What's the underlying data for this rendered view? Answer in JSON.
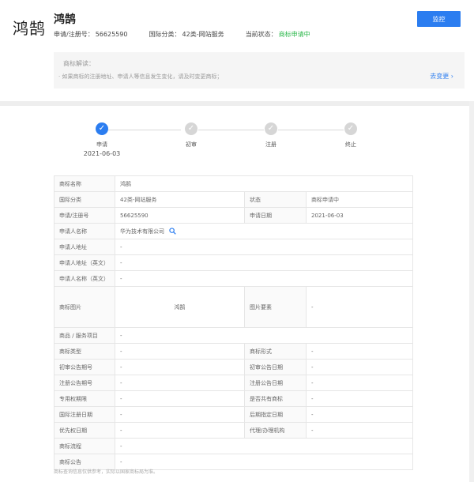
{
  "header": {
    "logo_text": "鸿鹄",
    "title": "鸿鹄",
    "reg_no_label": "申请/注册号：",
    "reg_no": "56625590",
    "class_label": "国际分类：",
    "class_value": "42类-网站服务",
    "status_label": "当前状态：",
    "status_value": "商标申请中",
    "watch_button": "监控"
  },
  "notice": {
    "title": "商标解读：",
    "body": "· 如果商标的注册地址、申请人等信息发生变化，请及时变更商标；",
    "link": "去变更 ›"
  },
  "progress": {
    "steps": [
      {
        "label": "申请",
        "date": "2021-06-03",
        "done": true
      },
      {
        "label": "初审",
        "date": "",
        "done": false
      },
      {
        "label": "注册",
        "date": "",
        "done": false
      },
      {
        "label": "终止",
        "date": "",
        "done": false
      }
    ]
  },
  "table": {
    "name_label": "商标名称",
    "name_value": "鸿鹄",
    "class_label": "国际分类",
    "class_value": "42类-网站服务",
    "status_label": "状态",
    "status_value": "商标申请中",
    "regno_label": "申请/注册号",
    "regno_value": "56625590",
    "appdate_label": "申请日期",
    "appdate_value": "2021-06-03",
    "applicant_label": "申请人名称",
    "applicant_value": "华为技术有限公司",
    "address_label": "申请人地址",
    "address_value": "-",
    "address_en_label": "申请人地址（英文）",
    "address_en_value": "-",
    "applicant_en_label": "申请人名称（英文）",
    "applicant_en_value": "-",
    "image_label": "商标图片",
    "image_text": "鸿鹄",
    "elements_label": "图片要素",
    "elements_value": "-",
    "goods_label": "商品 / 服务项目",
    "goods_value": "-",
    "type_label": "商标类型",
    "type_value": "-",
    "form_label": "商标形式",
    "form_value": "-",
    "prelim_no_label": "初审公告期号",
    "prelim_no_value": "-",
    "prelim_date_label": "初审公告日期",
    "prelim_date_value": "-",
    "reg_no_label": "注册公告期号",
    "reg_no_value": "-",
    "reg_date_label": "注册公告日期",
    "reg_date_value": "-",
    "excl_label": "专用权期限",
    "excl_value": "-",
    "shared_label": "是否共有商标",
    "shared_value": "-",
    "intl_date_label": "国际注册日期",
    "intl_date_value": "-",
    "later_date_label": "后期指定日期",
    "later_date_value": "-",
    "priority_label": "优先权日期",
    "priority_value": "-",
    "agent_label": "代理/办理机构",
    "agent_value": "-",
    "flow_label": "商标流程",
    "flow_value": "-",
    "announce_label": "商标公告",
    "announce_value": "-"
  },
  "footnote": "商标查询信息仅供参考，实际以国家商标局为准。",
  "colors": {
    "accent": "#2b7df0",
    "status_green": "#2fb94e"
  }
}
